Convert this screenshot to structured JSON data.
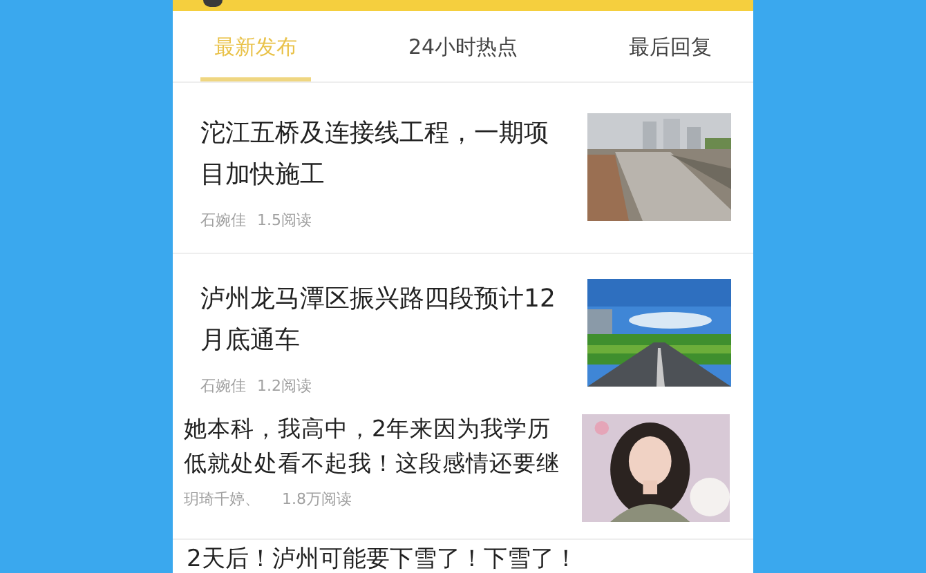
{
  "tabs": [
    {
      "label": "最新发布",
      "selected": true
    },
    {
      "label": "24小时热点",
      "selected": false
    },
    {
      "label": "最后回复",
      "selected": false
    }
  ],
  "articles": [
    {
      "kind": "standard",
      "title_lines": [
        "沱江五桥及连接线工程，一期项",
        "目加快施工"
      ],
      "author": "石婉佳",
      "reads": "1.5阅读"
    },
    {
      "kind": "standard",
      "title_lines": [
        "泸州龙马潭区振兴路四段预计12",
        "月底通车"
      ],
      "author": "石婉佳",
      "reads": "1.2阅读"
    },
    {
      "kind": "compact",
      "title_lines": [
        "她本科，我高中，2年来因为我学历",
        "低就处处看不起我！这段感情还要继"
      ],
      "author": "玥琦千婷、",
      "reads": "1.8万阅读"
    }
  ],
  "next_title": "2天后！泸州可能要下雪了！下雪了！"
}
